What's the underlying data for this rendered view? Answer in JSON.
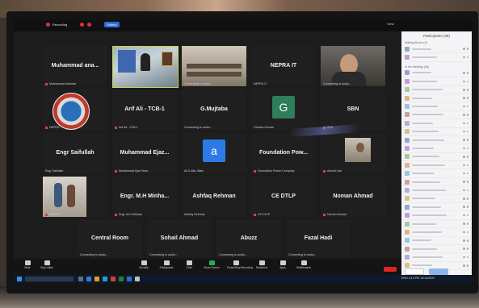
{
  "topbar": {
    "recording_label": "Recording",
    "grid_button_label": "Gallery",
    "view_label": "View"
  },
  "tiles": [
    {
      "name": "Muhammad ana...",
      "label": "Muhammad Inamdar"
    },
    {
      "name": "",
      "label": ""
    },
    {
      "name": "",
      "label": "Connecting to audio..."
    },
    {
      "name": "NEPRA IT",
      "label": "NEPRA IT"
    },
    {
      "name": "",
      "label": "Connecting to audio..."
    },
    {
      "name": "",
      "label": "NEPRA"
    },
    {
      "name": "Arif Ali - TCB-1",
      "label": "Arif Ali - TCB-1"
    },
    {
      "name": "G.Mujtaba",
      "label": "Connecting to audio..."
    },
    {
      "name": "",
      "label": "Ghulam Ahmad",
      "avatar": "G",
      "avatar_color": "#2e7d5b"
    },
    {
      "name": "SBN",
      "label": "SBN"
    },
    {
      "name": "Engr Saifullah",
      "label": "Engr Saifullah"
    },
    {
      "name": "Muhammad Ejaz...",
      "label": "Muhammad Ejaz Khan"
    },
    {
      "name": "",
      "label": "Ali & Alia Jillani",
      "avatar": "a",
      "avatar_color": "#2c7be5"
    },
    {
      "name": "Foundation Pow...",
      "label": "Foundation Power Company"
    },
    {
      "name": "",
      "label": "Ahmed Jan"
    },
    {
      "name": "",
      "label": "NEPRA"
    },
    {
      "name": "Engr. M.H Minha...",
      "label": "Engr. M.H Minhas"
    },
    {
      "name": "Ashfaq Rehman",
      "label": "Ashfaq Rehman"
    },
    {
      "name": "CE DTLP",
      "label": "CE DTLP"
    },
    {
      "name": "Noman Ahmad",
      "label": "Noman Ahmad"
    },
    {
      "name": "Central Room",
      "label": "Connecting to audio..."
    },
    {
      "name": "Sohail Ahmad",
      "label": "Connecting to audio..."
    },
    {
      "name": "Abuzz",
      "label": "Connecting to audio..."
    },
    {
      "name": "Fazal Hadi",
      "label": "Connecting to audio..."
    }
  ],
  "panel": {
    "title": "Participants (38)",
    "section_waiting": "Waiting Room (2)",
    "section_in_meeting": "In the Meeting (36)",
    "invite_label": "Invite",
    "mute_all_label": "Mute All"
  },
  "toolbar": {
    "items": [
      {
        "label": "Mute"
      },
      {
        "label": "Stop Video"
      },
      {
        "label": "Security"
      },
      {
        "label": "Participants"
      },
      {
        "label": "Chat"
      },
      {
        "label": "Share Screen"
      },
      {
        "label": "Pause/Stop Recording"
      },
      {
        "label": "Reactions"
      },
      {
        "label": "Apps"
      },
      {
        "label": "Whiteboards"
      }
    ],
    "leave_label": "End"
  },
  "taskbar": {
    "tray_text": "ENG  4:12 PM  12/14/2022"
  },
  "colors": {
    "accent": "#2c6ddb",
    "leave": "#e02424",
    "record": "#d93636"
  }
}
